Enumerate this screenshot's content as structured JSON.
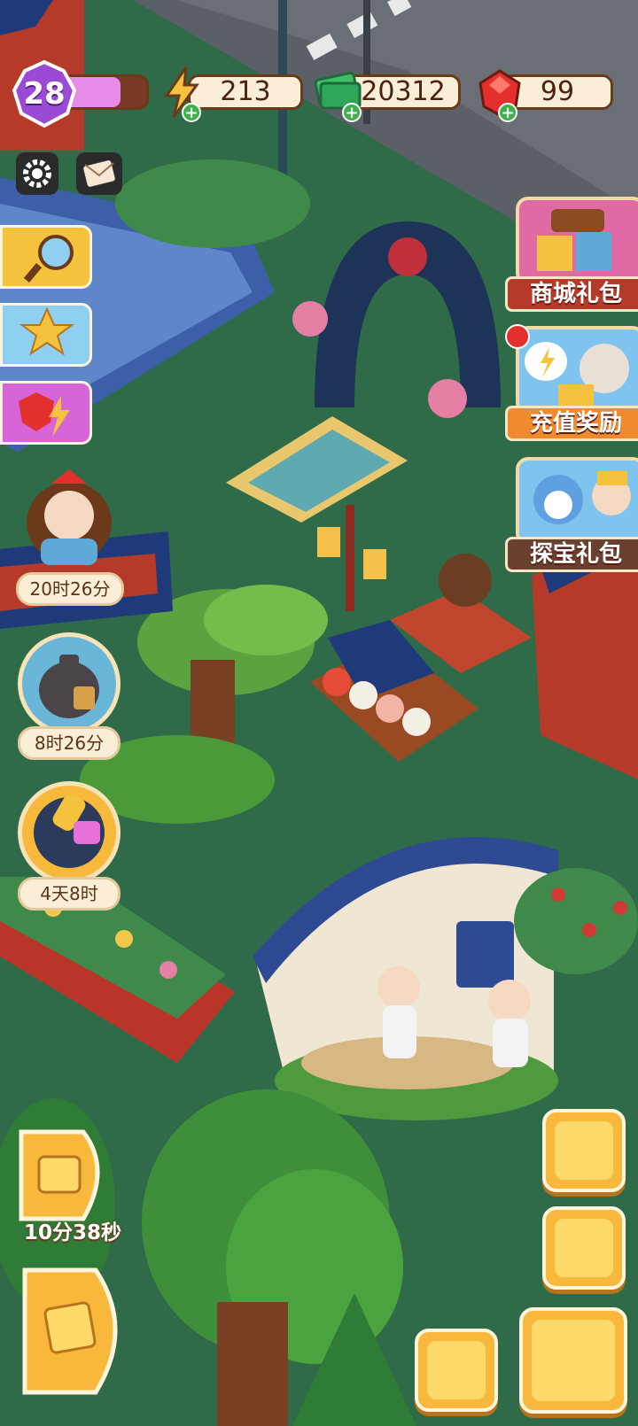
{
  "hud": {
    "level": "28",
    "xp_fraction": 0.72,
    "energy": "213",
    "cash": "20312",
    "gems": "99"
  },
  "right_promos": [
    {
      "label": "商城礼包"
    },
    {
      "label": "充值奖励"
    },
    {
      "label": "探宝礼包"
    }
  ],
  "left_events": [
    {
      "timer": "20时26分"
    },
    {
      "timer": "8时26分"
    },
    {
      "timer": "4天8时"
    }
  ],
  "bottom": {
    "daily_timer": "10分38秒"
  },
  "colors": {
    "grass": "#2f6b48",
    "accent_orange": "#f7b83b",
    "promo_red": "#b63a2a",
    "hud_cream": "#fbeed6"
  }
}
